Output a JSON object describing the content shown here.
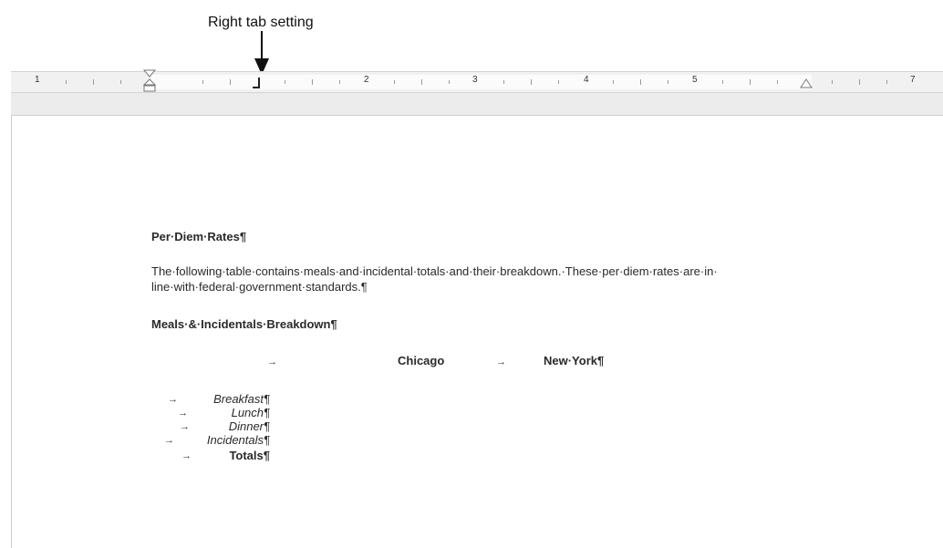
{
  "callout": {
    "label": "Right tab setting"
  },
  "ruler": {
    "numbers": [
      "1",
      "2",
      "3",
      "4",
      "5",
      "7"
    ]
  },
  "document": {
    "title": "Per·Diem·Rates¶",
    "paragraph_line1": "The·following·table·contains·meals·and·incidental·totals·and·their·breakdown.·These·per·diem·rates·are·in·",
    "paragraph_line2": "line·with·federal·government·standards.¶",
    "subheading": "Meals·&·Incidentals·Breakdown¶",
    "header_tab_arrow": "→",
    "col1_header": "Chicago",
    "col2_header": "New·York¶",
    "items": [
      "Breakfast¶",
      "Lunch¶",
      "Dinner¶",
      "Incidentals¶",
      "Totals¶"
    ],
    "tab_arrow": "→"
  }
}
